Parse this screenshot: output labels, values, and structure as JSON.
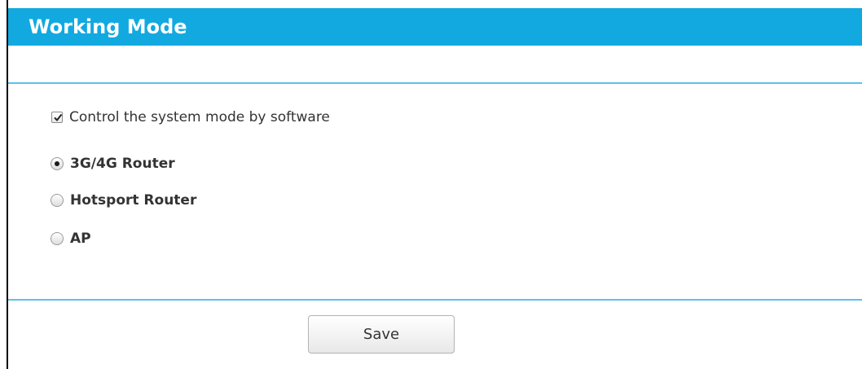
{
  "header": {
    "title": "Working Mode"
  },
  "software_control": {
    "label": "Control the system mode by software",
    "checked": true
  },
  "modes": [
    {
      "label": "3G/4G Router",
      "selected": true
    },
    {
      "label": "Hotsport Router",
      "selected": false
    },
    {
      "label": "AP",
      "selected": false
    }
  ],
  "actions": {
    "save_label": "Save"
  },
  "colors": {
    "header_bg": "#12a9e0",
    "divider": "#5bc1ea"
  }
}
